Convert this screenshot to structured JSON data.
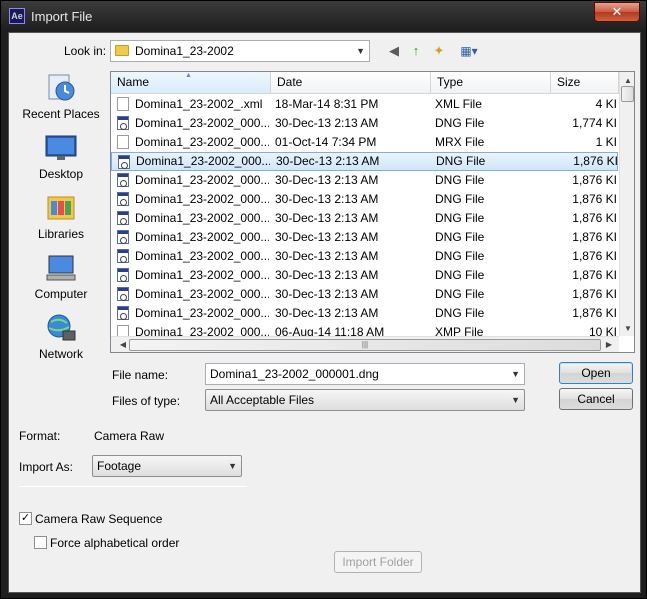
{
  "window": {
    "title": "Import File",
    "app_icon": "Ae",
    "close_glyph": "✕"
  },
  "lookin": {
    "label": "Look in:",
    "value": "Domina1_23-2002"
  },
  "toolbar": {
    "back_glyph": "◀",
    "up_glyph": "↑",
    "newfolder_glyph": "✦",
    "views_glyph": "▦▾"
  },
  "places": [
    {
      "label": "Recent Places",
      "icon": "recent-places-icon"
    },
    {
      "label": "Desktop",
      "icon": "desktop-icon"
    },
    {
      "label": "Libraries",
      "icon": "libraries-icon"
    },
    {
      "label": "Computer",
      "icon": "computer-icon"
    },
    {
      "label": "Network",
      "icon": "network-icon"
    }
  ],
  "columns": {
    "name": "Name",
    "date": "Date",
    "type": "Type",
    "size": "Size"
  },
  "files": [
    {
      "name": "Domina1_23-2002_.xml",
      "date": "18-Mar-14 8:31 PM",
      "type": "XML File",
      "size": "4 KI",
      "icon": "xml"
    },
    {
      "name": "Domina1_23-2002_000...",
      "date": "30-Dec-13 2:13 AM",
      "type": "DNG File",
      "size": "1,774 KI",
      "icon": "dng"
    },
    {
      "name": "Domina1_23-2002_000...",
      "date": "01-Oct-14 7:34 PM",
      "type": "MRX File",
      "size": "1 KI",
      "icon": "mrx"
    },
    {
      "name": "Domina1_23-2002_000...",
      "date": "30-Dec-13 2:13 AM",
      "type": "DNG File",
      "size": "1,876 KI",
      "icon": "dng",
      "selected": true
    },
    {
      "name": "Domina1_23-2002_000...",
      "date": "30-Dec-13 2:13 AM",
      "type": "DNG File",
      "size": "1,876 KI",
      "icon": "dng"
    },
    {
      "name": "Domina1_23-2002_000...",
      "date": "30-Dec-13 2:13 AM",
      "type": "DNG File",
      "size": "1,876 KI",
      "icon": "dng"
    },
    {
      "name": "Domina1_23-2002_000...",
      "date": "30-Dec-13 2:13 AM",
      "type": "DNG File",
      "size": "1,876 KI",
      "icon": "dng"
    },
    {
      "name": "Domina1_23-2002_000...",
      "date": "30-Dec-13 2:13 AM",
      "type": "DNG File",
      "size": "1,876 KI",
      "icon": "dng"
    },
    {
      "name": "Domina1_23-2002_000...",
      "date": "30-Dec-13 2:13 AM",
      "type": "DNG File",
      "size": "1,876 KI",
      "icon": "dng"
    },
    {
      "name": "Domina1_23-2002_000...",
      "date": "30-Dec-13 2:13 AM",
      "type": "DNG File",
      "size": "1,876 KI",
      "icon": "dng"
    },
    {
      "name": "Domina1_23-2002_000...",
      "date": "30-Dec-13 2:13 AM",
      "type": "DNG File",
      "size": "1,876 KI",
      "icon": "dng"
    },
    {
      "name": "Domina1_23-2002_000...",
      "date": "30-Dec-13 2:13 AM",
      "type": "DNG File",
      "size": "1,876 KI",
      "icon": "dng"
    },
    {
      "name": "Domina1_23-2002_000...",
      "date": "06-Aug-14 11:18 AM",
      "type": "XMP File",
      "size": "10 KI",
      "icon": "xmp"
    }
  ],
  "filename": {
    "label": "File name:",
    "value": "Domina1_23-2002_000001.dng"
  },
  "filetype": {
    "label": "Files of type:",
    "value": "All Acceptable Files"
  },
  "buttons": {
    "open": "Open",
    "cancel": "Cancel",
    "import_folder": "Import Folder"
  },
  "format": {
    "label": "Format:",
    "value": "Camera Raw"
  },
  "import_as": {
    "label": "Import As:",
    "value": "Footage"
  },
  "options": {
    "sequence": {
      "label": "Camera Raw Sequence",
      "checked": true,
      "mark": "✓"
    },
    "alphabetical": {
      "label": "Force alphabetical order",
      "checked": false
    }
  },
  "scroll": {
    "up": "▲",
    "down": "▼",
    "grip": "|||"
  },
  "sort_glyph": "▲",
  "dropdown_glyph": "▼"
}
